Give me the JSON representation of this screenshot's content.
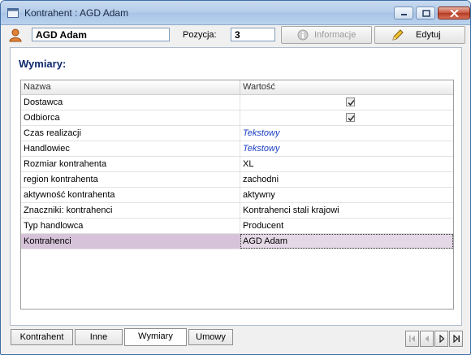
{
  "window": {
    "title": "Kontrahent : AGD Adam",
    "icon": "app-window-icon"
  },
  "toolbar": {
    "name_value": "AGD Adam",
    "position_label": "Pozycja:",
    "position_value": "3",
    "info_label": "Informacje",
    "edit_label": "Edytuj"
  },
  "section": {
    "title": "Wymiary:"
  },
  "grid": {
    "headers": [
      "Nazwa",
      "Wartość"
    ],
    "rows": [
      {
        "name": "Dostawca",
        "value": "",
        "checked": true
      },
      {
        "name": "Odbiorca",
        "value": "",
        "checked": true
      },
      {
        "name": "Czas realizacji",
        "value": "Tekstowy"
      },
      {
        "name": "Handlowiec",
        "value": "Tekstowy"
      },
      {
        "name": "Rozmiar kontrahenta",
        "value": "XL"
      },
      {
        "name": "region kontrahenta",
        "value": "zachodni"
      },
      {
        "name": "aktywność kontrahenta",
        "value": "aktywny"
      },
      {
        "name": "Znaczniki: kontrahenci",
        "value": "Kontrahenci stali krajowi"
      },
      {
        "name": "Typ handlowca",
        "value": "Producent"
      },
      {
        "name": "Kontrahenci",
        "value": "AGD Adam"
      }
    ]
  },
  "tabs": [
    "Kontrahent",
    "Inne",
    "Wymiary",
    "Umowy"
  ],
  "active_tab": "Wymiary",
  "colors": {
    "accent_title": "#0d2a6c",
    "link_value": "#1c3fc4",
    "selected_row": "#d6c3d9"
  }
}
